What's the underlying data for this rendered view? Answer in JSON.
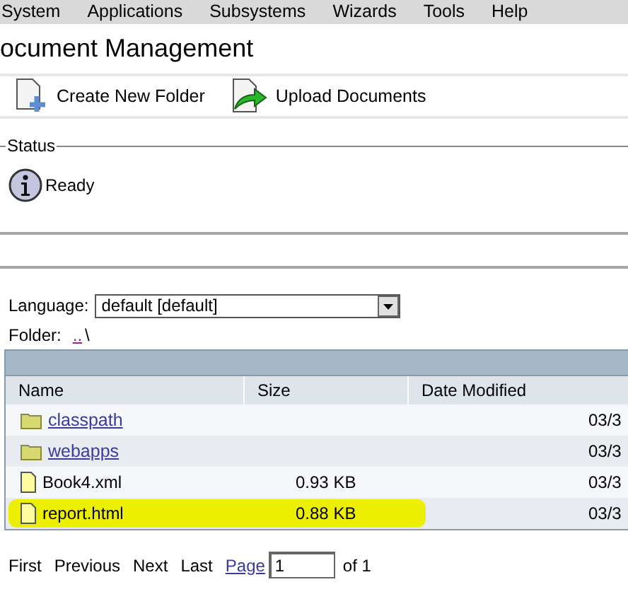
{
  "menu": [
    "System",
    "Applications",
    "Subsystems",
    "Wizards",
    "Tools",
    "Help"
  ],
  "title": "ocument Management",
  "toolbar": [
    {
      "label": "Create New Folder",
      "kind": "create"
    },
    {
      "label": "Upload Documents",
      "kind": "upload"
    }
  ],
  "status": {
    "legend": "Status",
    "message": "Ready"
  },
  "language": {
    "label": "Language:",
    "value": "default [default]"
  },
  "folder": {
    "label": "Folder:",
    "link": "..",
    "path": "\\"
  },
  "table": {
    "columns": [
      "Name",
      "Size",
      "Date Modified"
    ],
    "rows": [
      {
        "kind": "folder",
        "name": "classpath",
        "date": "03/3",
        "highlighted": false
      },
      {
        "kind": "folder",
        "name": "webapps",
        "date": "03/3",
        "highlighted": false
      },
      {
        "kind": "file",
        "name": "Book4.xml",
        "size": "0.93 KB",
        "date": "03/3",
        "highlighted": false
      },
      {
        "kind": "file",
        "name": "report.html",
        "size": "0.88 KB",
        "date": "03/3",
        "highlighted": true
      }
    ]
  },
  "pager": {
    "first": "First",
    "previous": "Previous",
    "next": "Next",
    "last": "Last",
    "page_label": "Page",
    "page": "1",
    "of": "of 1"
  }
}
